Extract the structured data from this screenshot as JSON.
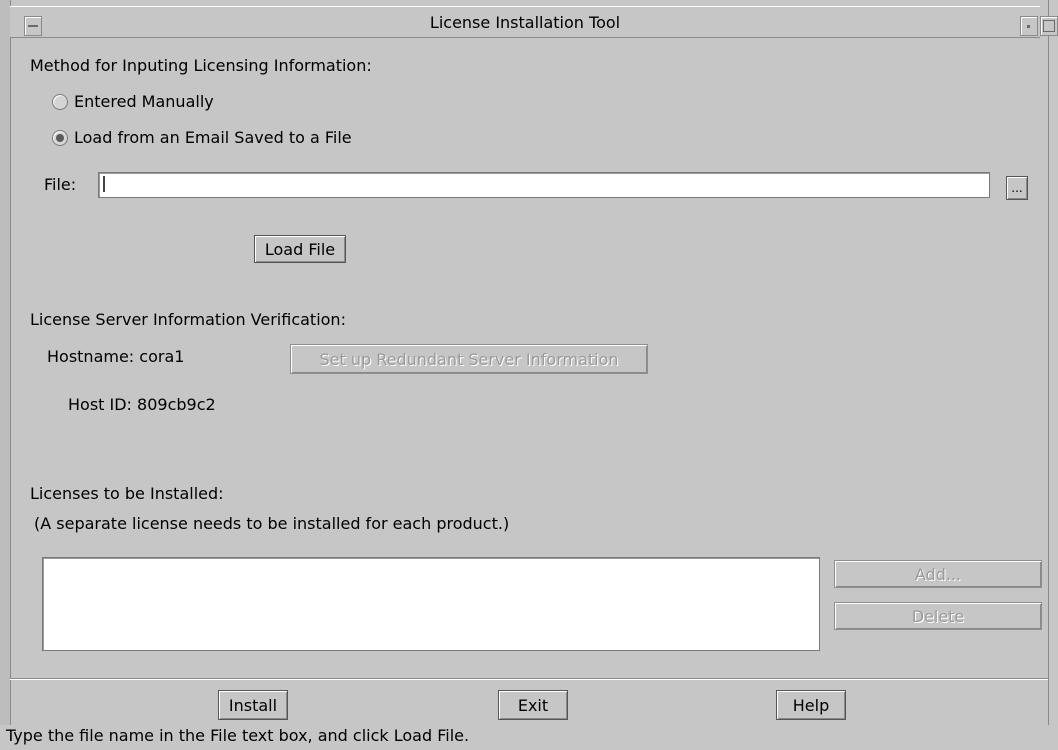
{
  "window": {
    "title": "License Installation Tool"
  },
  "method": {
    "heading": "Method for Inputing Licensing Information:",
    "options": [
      {
        "label": "Entered Manually",
        "checked": false
      },
      {
        "label": "Load from an Email Saved to a File",
        "checked": true
      }
    ]
  },
  "file": {
    "label": "File:",
    "value": "",
    "browse_label": "...",
    "load_label": "Load File"
  },
  "server": {
    "heading": "License Server Information Verification:",
    "hostname_label": "Hostname: cora1",
    "hostid_label": "Host ID: 809cb9c2",
    "redundant_button": "Set up Redundant Server Information"
  },
  "licenses": {
    "heading": "Licenses to be Installed:",
    "note": "(A separate license needs to be installed for each product.)",
    "add_label": "Add...",
    "delete_label": "Delete",
    "items": []
  },
  "footer": {
    "install_label": "Install",
    "exit_label": "Exit",
    "help_label": "Help",
    "status": "Type the file name in the File text box, and click Load File."
  }
}
